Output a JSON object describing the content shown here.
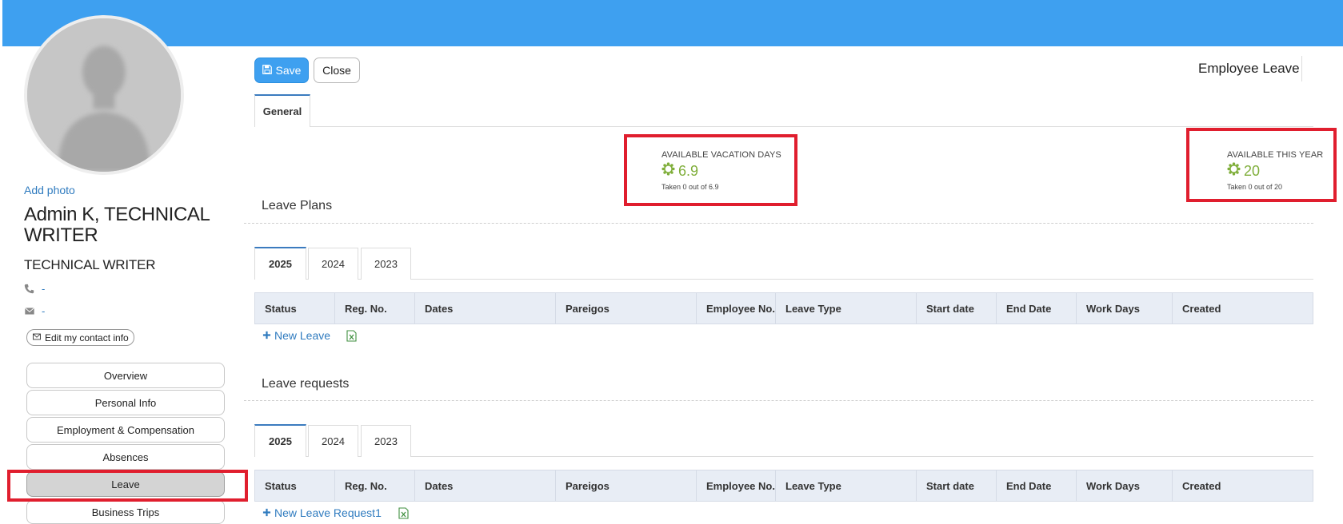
{
  "profile": {
    "add_photo": "Add photo",
    "name": "Admin K, TECHNICAL WRITER",
    "title": "TECHNICAL WRITER",
    "phone": "-",
    "email": "-",
    "edit_contact": "Edit my contact info"
  },
  "nav": {
    "items": [
      {
        "label": "Overview"
      },
      {
        "label": "Personal Info"
      },
      {
        "label": "Employment & Compensation"
      },
      {
        "label": "Absences"
      },
      {
        "label": "Leave"
      },
      {
        "label": "Business Trips"
      }
    ],
    "active": "Leave"
  },
  "toolbar": {
    "save_label": "Save",
    "close_label": "Close",
    "page_title": "Employee Leave"
  },
  "main_tabs": [
    {
      "label": "General"
    }
  ],
  "stats": {
    "vacation": {
      "label": "AVAILABLE VACATION DAYS",
      "value": "6.9",
      "sub": "Taken 0 out of 6.9"
    },
    "this_year": {
      "label": "AVAILABLE THIS YEAR",
      "value": "20",
      "sub": "Taken 0 out of 20"
    }
  },
  "leave_plans": {
    "title": "Leave Plans",
    "years": [
      "2025",
      "2024",
      "2023"
    ],
    "active_year": "2025",
    "columns": [
      "Status",
      "Reg. No.",
      "Dates",
      "Pareigos",
      "Employee No.",
      "Leave Type",
      "Start date",
      "End Date",
      "Work Days",
      "Created"
    ],
    "new_label": "New Leave"
  },
  "leave_requests": {
    "title": "Leave requests",
    "years": [
      "2025",
      "2024",
      "2023"
    ],
    "active_year": "2025",
    "columns": [
      "Status",
      "Reg. No.",
      "Dates",
      "Pareigos",
      "Employee No.",
      "Leave Type",
      "Start date",
      "End Date",
      "Work Days",
      "Created"
    ],
    "new_label": "New Leave Request1"
  },
  "colors": {
    "topbar": "#3ea0f0",
    "accent": "#3ea0f0",
    "link": "#2f7bbf",
    "stat_green": "#7fae3a",
    "highlight": "#e01e2e"
  },
  "icons": [
    "save-icon",
    "phone-icon",
    "envelope-icon",
    "plus-icon",
    "excel-icon",
    "spinner-icon"
  ]
}
